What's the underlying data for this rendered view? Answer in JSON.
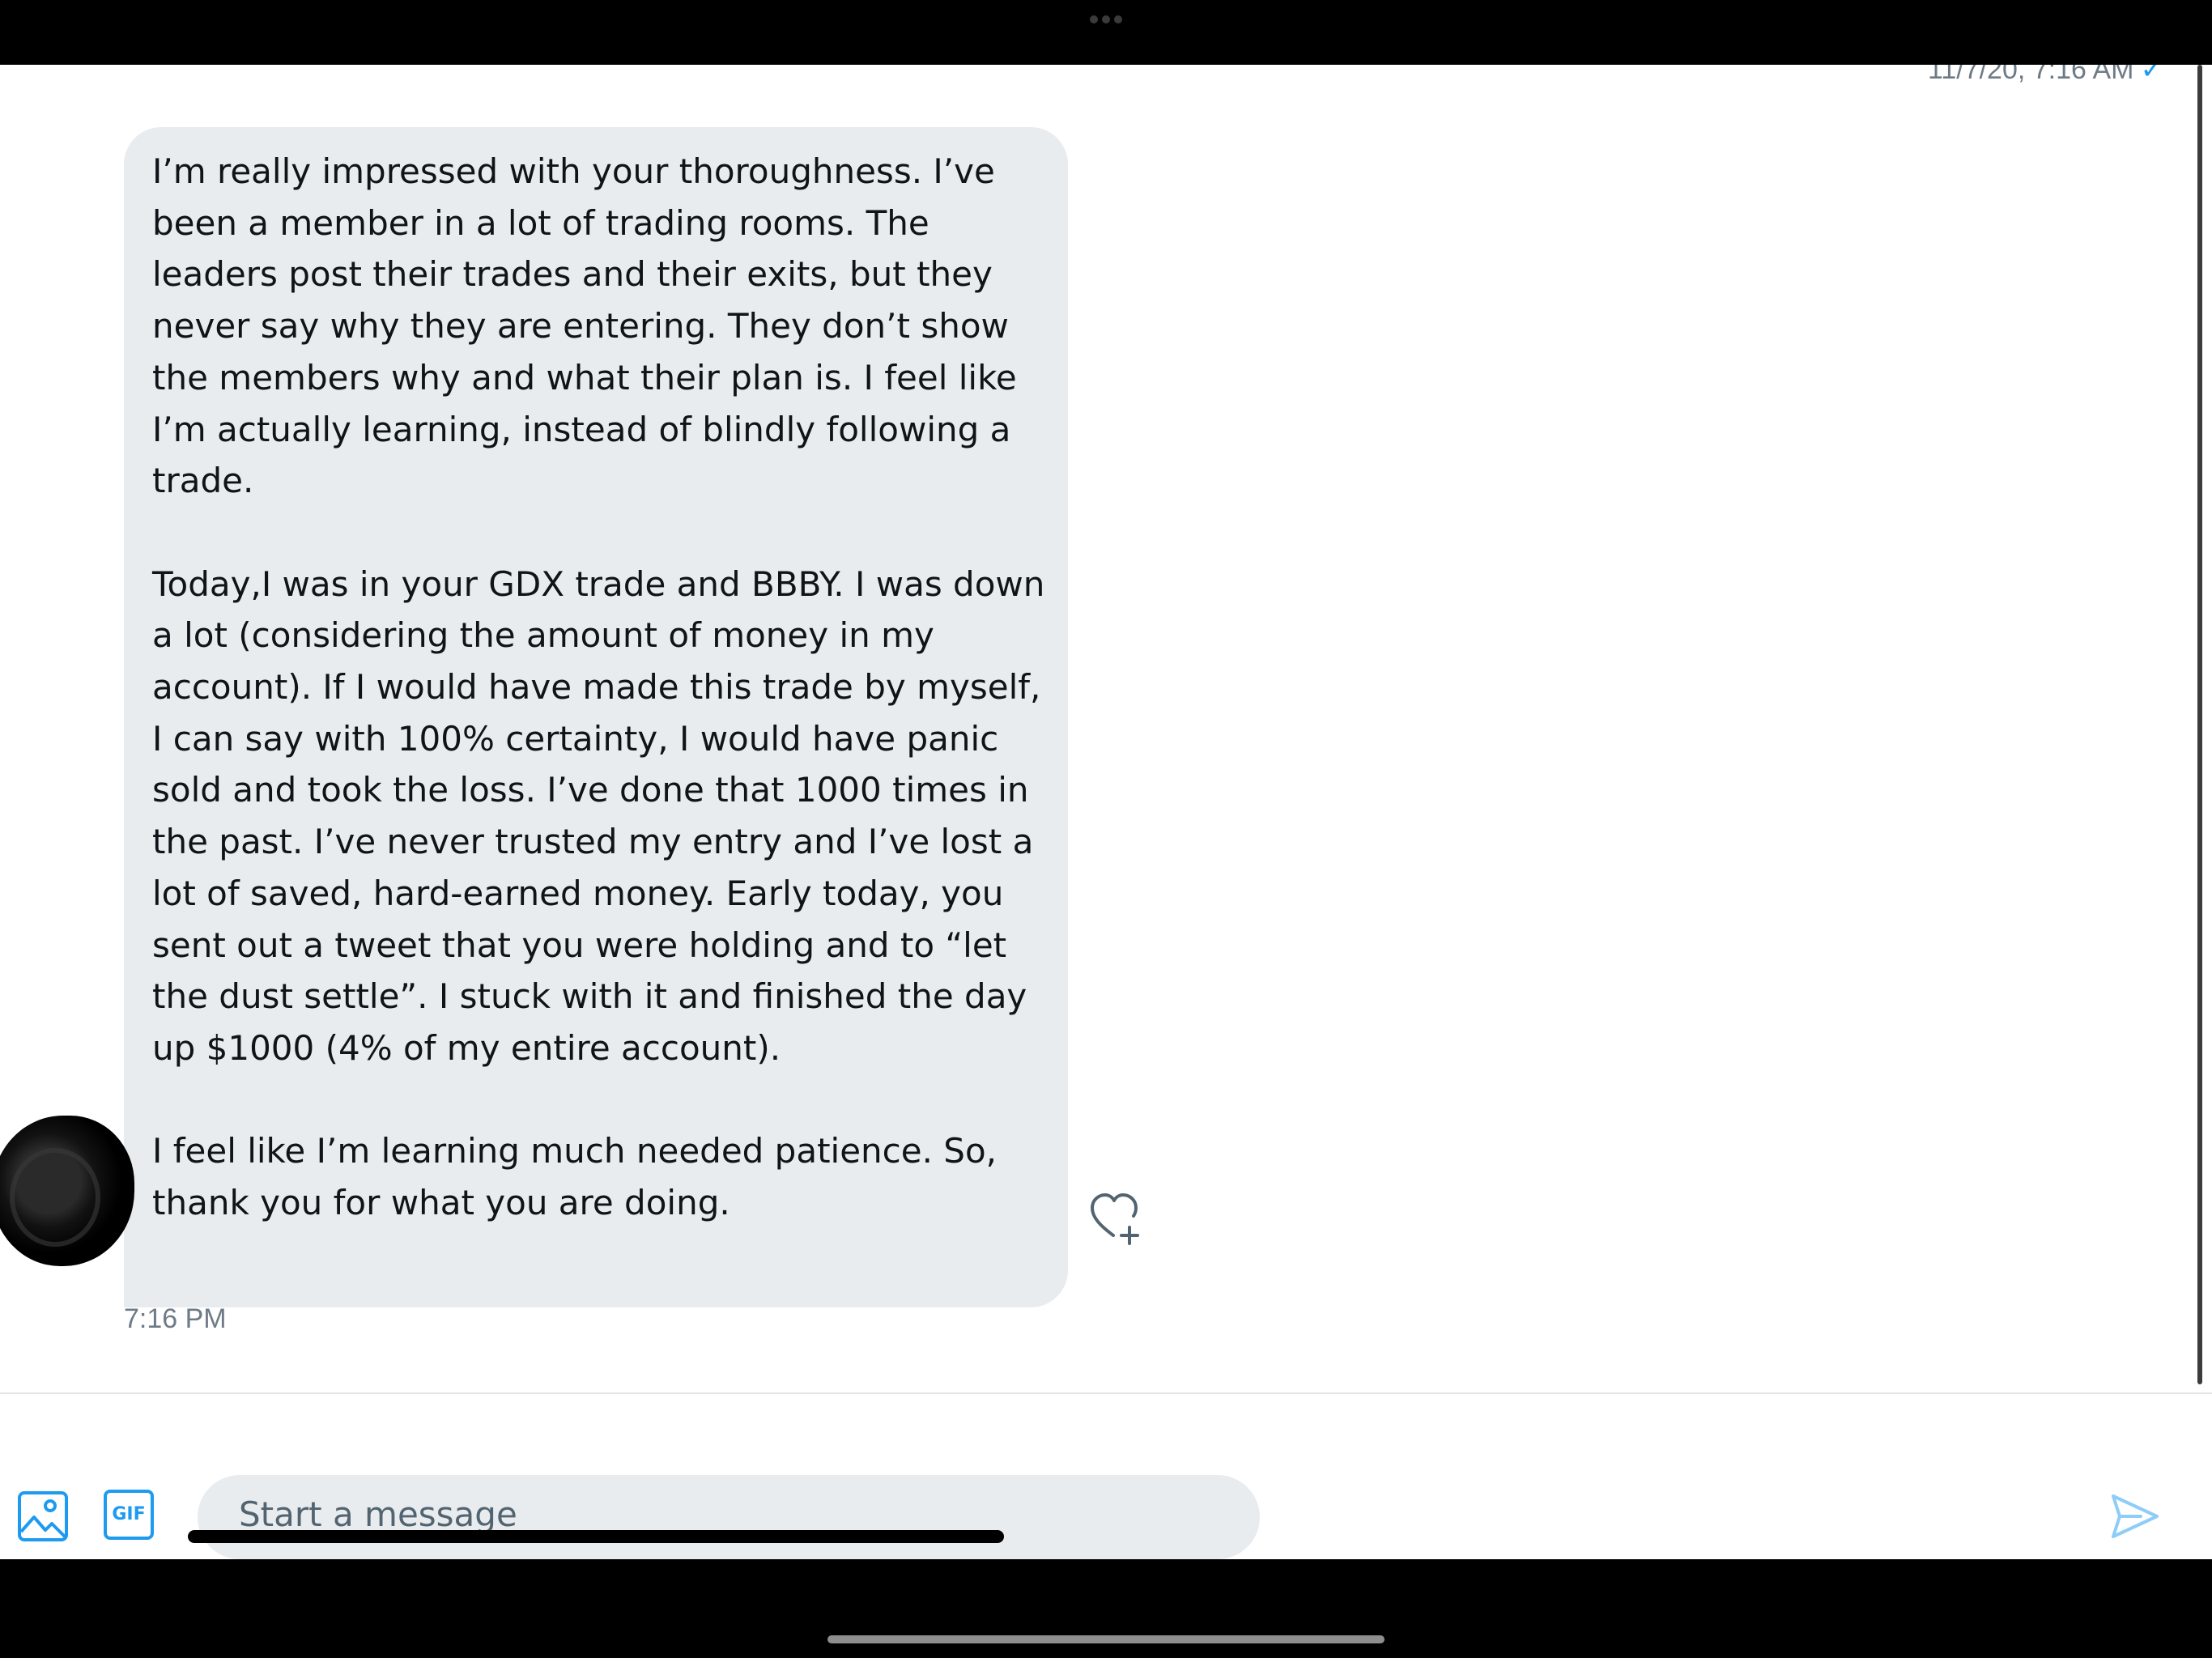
{
  "conversation": {
    "previous_timestamp": "11/7/20, 7:16 AM",
    "read_check": "✓",
    "message": {
      "paragraphs": [
        "I’m really impressed with your thoroughness. I’ve been a member in a lot of trading rooms. The leaders post their trades and their exits, but they never say why they are entering. They don’t show the members why and what their plan is. I feel like I’m actually learning, instead of blindly following a trade.",
        "Today,I was in your GDX trade and BBBY. I was down a lot (considering the amount of money in my account). If I would have made this trade by myself, I can say with 100% certainty, I would have panic sold and took the loss. I’ve done that 1000 times in the past. I’ve never trusted my entry and I’ve lost a lot of saved, hard-earned money. Early today, you sent out a tweet that you were holding and to “let the dust settle”. I stuck with it and finished the day up $1000 (4% of my entire account).",
        "I feel like I’m learning much needed patience. So, thank you for what you are doing."
      ],
      "time": "7:16 PM"
    }
  },
  "composer": {
    "placeholder": "Start a message",
    "gif_label": "GIF",
    "icons": {
      "media": "image-icon",
      "gif": "gif-icon",
      "send": "send-icon",
      "react": "heart-plus-icon"
    }
  },
  "colors": {
    "accent": "#1d9bf0",
    "bubble": "#e8ecef",
    "text": "#0f1419",
    "muted": "#6e7b86"
  }
}
